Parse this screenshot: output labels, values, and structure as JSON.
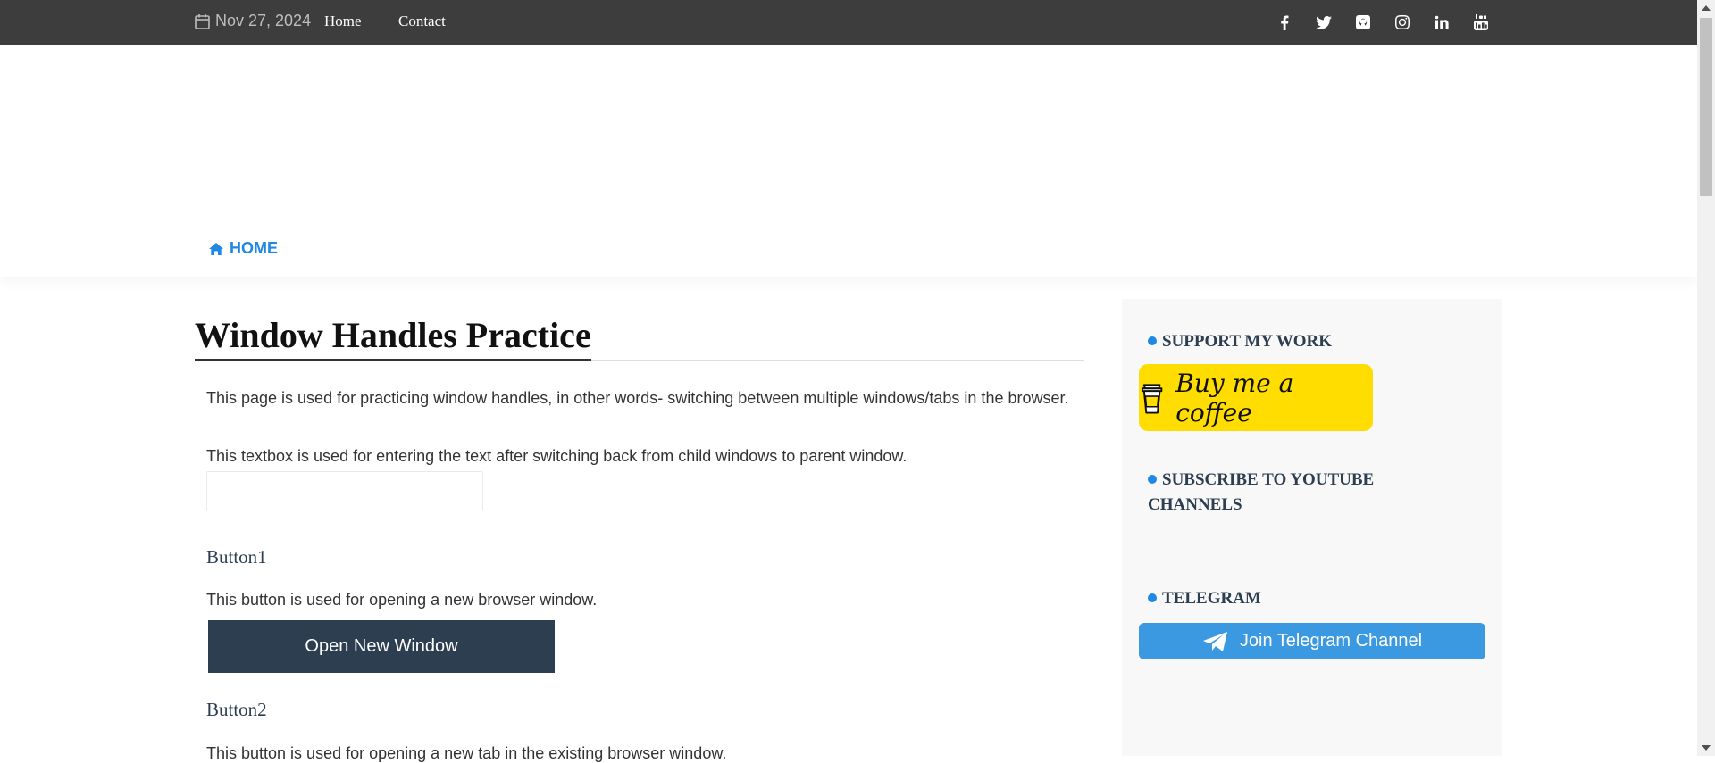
{
  "topbar": {
    "date": "Nov 27, 2024",
    "nav": [
      "Home",
      "Contact"
    ],
    "social_icons": [
      "facebook-icon",
      "twitter-icon",
      "github-icon",
      "instagram-icon",
      "linkedin-icon",
      "youtube-icon"
    ]
  },
  "breadcrumb": {
    "home_label": "HOME"
  },
  "main": {
    "title": "Window Handles Practice",
    "intro": "This page is used for practicing window handles, in other words- switching between multiple windows/tabs in the browser.",
    "textbox_label": "This textbox is used for entering the text after switching back from child windows to parent window.",
    "textbox_value": "",
    "button1": {
      "heading": "Button1",
      "description": "This button is used for opening a new browser window.",
      "label": "Open New Window"
    },
    "button2": {
      "heading": "Button2",
      "description": "This button is used for opening a new tab in the existing browser window."
    }
  },
  "sidebar": {
    "support_title": "SUPPORT MY WORK",
    "coffee_label": "Buy me a coffee",
    "youtube_title_line1": "SUBSCRIBE TO YOUTUBE",
    "youtube_title_line2": "CHANNELS",
    "telegram_title": "TELEGRAM",
    "telegram_button": "Join Telegram Channel"
  },
  "colors": {
    "topbar_bg": "#3d3d3d",
    "accent_blue": "#1e88e5",
    "button_dark": "#2c3e50",
    "coffee_yellow": "#ffdd00",
    "telegram_blue": "#3a99e0"
  }
}
